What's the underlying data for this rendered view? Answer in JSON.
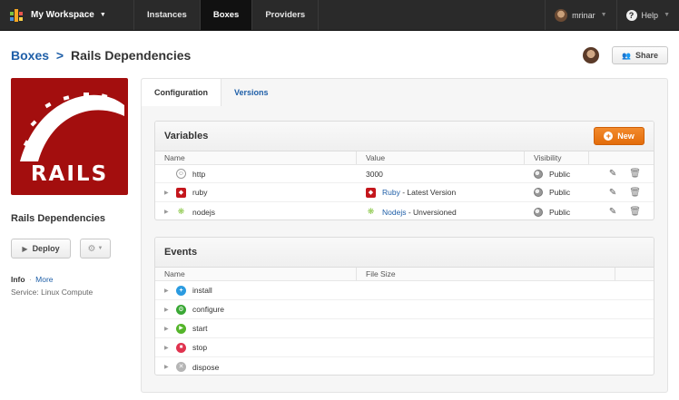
{
  "nav": {
    "workspace": "My Workspace",
    "items": [
      {
        "label": "Instances",
        "active": false
      },
      {
        "label": "Boxes",
        "active": true
      },
      {
        "label": "Providers",
        "active": false
      }
    ],
    "user": "mrinar",
    "help": "Help"
  },
  "header": {
    "breadcrumb_root": "Boxes",
    "breadcrumb_sep": ">",
    "breadcrumb_current": "Rails Dependencies",
    "share_label": "Share"
  },
  "sidebar": {
    "logo_text": "RAILS",
    "box_title": "Rails Dependencies",
    "deploy_label": "Deploy",
    "info_label": "Info",
    "info_sep": "·",
    "more_label": "More",
    "service_label": "Service:",
    "service_value": "Linux Compute"
  },
  "tabs": [
    {
      "label": "Configuration",
      "active": true
    },
    {
      "label": "Versions",
      "active": false
    }
  ],
  "variables": {
    "title": "Variables",
    "new_label": "New",
    "columns": [
      "Name",
      "Value",
      "Visibility"
    ],
    "rows": [
      {
        "name": "http",
        "expandable": false,
        "icon": "user-icon",
        "value": "3000",
        "value_link": "",
        "value_suffix": "",
        "value_icon": "",
        "visibility": "Public"
      },
      {
        "name": "ruby",
        "expandable": true,
        "icon": "ruby-icon",
        "value": "",
        "value_link": "Ruby",
        "value_suffix": " - Latest Version",
        "value_icon": "ruby-icon",
        "visibility": "Public"
      },
      {
        "name": "nodejs",
        "expandable": true,
        "icon": "nodejs-icon",
        "value": "",
        "value_link": "Nodejs",
        "value_suffix": " - Unversioned",
        "value_icon": "nodejs-icon",
        "visibility": "Public"
      }
    ]
  },
  "events": {
    "title": "Events",
    "columns": [
      "Name",
      "File Size"
    ],
    "rows": [
      {
        "name": "install",
        "icon": "install-icon",
        "color": "#2b9be0"
      },
      {
        "name": "configure",
        "icon": "configure-icon",
        "color": "#3aa835"
      },
      {
        "name": "start",
        "icon": "start-icon",
        "color": "#55b52b"
      },
      {
        "name": "stop",
        "icon": "stop-icon",
        "color": "#e0334f"
      },
      {
        "name": "dispose",
        "icon": "dispose-icon",
        "color": "#b5b5b5"
      }
    ]
  },
  "colors": {
    "nav_bg": "#2a2a2a",
    "link": "#1f5fa8",
    "rails_red": "#a30e0e",
    "new_button": "#e36c0a"
  }
}
